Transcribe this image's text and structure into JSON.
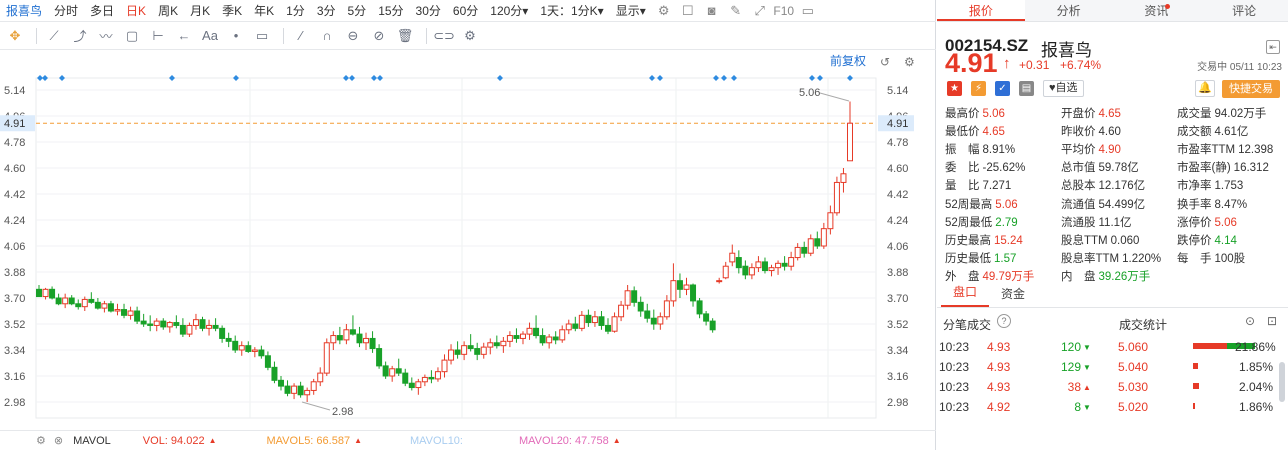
{
  "toolbar": {
    "timeframes": [
      {
        "label": "报喜鸟",
        "state": "stock"
      },
      {
        "label": "分时",
        "state": ""
      },
      {
        "label": "多日",
        "state": ""
      },
      {
        "label": "日K",
        "state": "active"
      },
      {
        "label": "周K",
        "state": ""
      },
      {
        "label": "月K",
        "state": ""
      },
      {
        "label": "季K",
        "state": ""
      },
      {
        "label": "年K",
        "state": ""
      },
      {
        "label": "1分",
        "state": ""
      },
      {
        "label": "3分",
        "state": ""
      },
      {
        "label": "5分",
        "state": ""
      },
      {
        "label": "15分",
        "state": ""
      },
      {
        "label": "30分",
        "state": ""
      },
      {
        "label": "60分",
        "state": ""
      },
      {
        "label": "120分",
        "state": "dropdown"
      },
      {
        "label": "1天：1分K",
        "state": "dropdown"
      },
      {
        "label": "显示",
        "state": "dropdown"
      }
    ],
    "icons": [
      "settings-icon",
      "checkbox-icon",
      "camera-icon",
      "pencil-icon",
      "expand-icon",
      "f10-icon",
      "window-icon"
    ],
    "f10_label": "F10"
  },
  "drawing_tools": [
    "cursor-icon",
    "line-icon",
    "ray-icon",
    "wave-icon",
    "rect-icon",
    "measure-icon",
    "arrow-icon",
    "text-icon",
    "comment-icon",
    "ruler-icon",
    "magnet-icon",
    "lock-icon",
    "hide-icon",
    "delete-icon",
    "toggle-icon",
    "settings-icon"
  ],
  "text_tool_label": "Aa",
  "chart": {
    "adjust_label": "前复权",
    "price_levels": [
      "5.14",
      "4.96",
      "4.78",
      "4.60",
      "4.42",
      "4.24",
      "4.06",
      "3.88",
      "3.70",
      "3.52",
      "3.34",
      "3.16",
      "2.98"
    ],
    "current_marker": "4.91",
    "high_annotation": "5.06",
    "low_annotation": "2.98"
  },
  "chart_data": {
    "type": "candlestick",
    "ylim": [
      2.9,
      5.14
    ],
    "candles": [
      [
        3.76,
        3.79,
        3.71,
        3.71
      ],
      [
        3.71,
        3.77,
        3.69,
        3.76
      ],
      [
        3.76,
        3.78,
        3.69,
        3.7
      ],
      [
        3.7,
        3.73,
        3.65,
        3.66
      ],
      [
        3.66,
        3.73,
        3.63,
        3.7
      ],
      [
        3.7,
        3.72,
        3.65,
        3.66
      ],
      [
        3.66,
        3.69,
        3.62,
        3.64
      ],
      [
        3.64,
        3.71,
        3.61,
        3.69
      ],
      [
        3.69,
        3.74,
        3.66,
        3.67
      ],
      [
        3.67,
        3.7,
        3.62,
        3.63
      ],
      [
        3.63,
        3.68,
        3.6,
        3.66
      ],
      [
        3.66,
        3.68,
        3.6,
        3.61
      ],
      [
        3.61,
        3.66,
        3.58,
        3.62
      ],
      [
        3.62,
        3.66,
        3.56,
        3.58
      ],
      [
        3.58,
        3.64,
        3.55,
        3.61
      ],
      [
        3.61,
        3.64,
        3.52,
        3.54
      ],
      [
        3.54,
        3.59,
        3.5,
        3.52
      ],
      [
        3.52,
        3.58,
        3.47,
        3.51
      ],
      [
        3.51,
        3.56,
        3.47,
        3.54
      ],
      [
        3.54,
        3.56,
        3.48,
        3.5
      ],
      [
        3.5,
        3.54,
        3.46,
        3.53
      ],
      [
        3.53,
        3.58,
        3.49,
        3.51
      ],
      [
        3.51,
        3.56,
        3.43,
        3.45
      ],
      [
        3.45,
        3.53,
        3.43,
        3.51
      ],
      [
        3.51,
        3.59,
        3.48,
        3.55
      ],
      [
        3.55,
        3.57,
        3.47,
        3.49
      ],
      [
        3.49,
        3.55,
        3.44,
        3.51
      ],
      [
        3.51,
        3.56,
        3.47,
        3.49
      ],
      [
        3.49,
        3.51,
        3.39,
        3.42
      ],
      [
        3.42,
        3.46,
        3.36,
        3.4
      ],
      [
        3.4,
        3.44,
        3.32,
        3.34
      ],
      [
        3.34,
        3.4,
        3.3,
        3.37
      ],
      [
        3.37,
        3.4,
        3.32,
        3.33
      ],
      [
        3.33,
        3.36,
        3.29,
        3.34
      ],
      [
        3.34,
        3.37,
        3.28,
        3.3
      ],
      [
        3.3,
        3.33,
        3.2,
        3.22
      ],
      [
        3.22,
        3.26,
        3.11,
        3.13
      ],
      [
        3.13,
        3.16,
        3.06,
        3.09
      ],
      [
        3.09,
        3.13,
        3.02,
        3.04
      ],
      [
        3.04,
        3.11,
        3.0,
        3.09
      ],
      [
        3.09,
        3.12,
        3.01,
        3.03
      ],
      [
        3.03,
        3.08,
        2.98,
        3.06
      ],
      [
        3.06,
        3.14,
        3.03,
        3.12
      ],
      [
        3.12,
        3.22,
        3.09,
        3.18
      ],
      [
        3.18,
        3.42,
        3.16,
        3.39
      ],
      [
        3.39,
        3.47,
        3.34,
        3.44
      ],
      [
        3.44,
        3.5,
        3.38,
        3.41
      ],
      [
        3.41,
        3.52,
        3.38,
        3.48
      ],
      [
        3.48,
        3.58,
        3.44,
        3.45
      ],
      [
        3.45,
        3.5,
        3.36,
        3.39
      ],
      [
        3.39,
        3.46,
        3.34,
        3.42
      ],
      [
        3.42,
        3.47,
        3.32,
        3.35
      ],
      [
        3.35,
        3.38,
        3.21,
        3.23
      ],
      [
        3.23,
        3.26,
        3.14,
        3.16
      ],
      [
        3.16,
        3.23,
        3.12,
        3.21
      ],
      [
        3.21,
        3.28,
        3.16,
        3.18
      ],
      [
        3.18,
        3.21,
        3.09,
        3.11
      ],
      [
        3.11,
        3.15,
        3.06,
        3.08
      ],
      [
        3.08,
        3.14,
        3.03,
        3.12
      ],
      [
        3.12,
        3.17,
        3.09,
        3.15
      ],
      [
        3.15,
        3.2,
        3.11,
        3.14
      ],
      [
        3.14,
        3.22,
        3.12,
        3.19
      ],
      [
        3.19,
        3.31,
        3.15,
        3.27
      ],
      [
        3.27,
        3.38,
        3.24,
        3.34
      ],
      [
        3.34,
        3.4,
        3.28,
        3.31
      ],
      [
        3.31,
        3.4,
        3.27,
        3.37
      ],
      [
        3.37,
        3.45,
        3.33,
        3.35
      ],
      [
        3.35,
        3.39,
        3.27,
        3.31
      ],
      [
        3.31,
        3.39,
        3.28,
        3.36
      ],
      [
        3.36,
        3.42,
        3.31,
        3.39
      ],
      [
        3.39,
        3.44,
        3.35,
        3.37
      ],
      [
        3.37,
        3.43,
        3.32,
        3.4
      ],
      [
        3.4,
        3.47,
        3.36,
        3.44
      ],
      [
        3.44,
        3.49,
        3.39,
        3.42
      ],
      [
        3.42,
        3.47,
        3.38,
        3.45
      ],
      [
        3.45,
        3.53,
        3.41,
        3.49
      ],
      [
        3.49,
        3.58,
        3.42,
        3.44
      ],
      [
        3.44,
        3.49,
        3.37,
        3.39
      ],
      [
        3.39,
        3.45,
        3.35,
        3.43
      ],
      [
        3.43,
        3.47,
        3.38,
        3.41
      ],
      [
        3.41,
        3.51,
        3.39,
        3.48
      ],
      [
        3.48,
        3.55,
        3.45,
        3.52
      ],
      [
        3.52,
        3.57,
        3.47,
        3.49
      ],
      [
        3.49,
        3.61,
        3.47,
        3.58
      ],
      [
        3.58,
        3.62,
        3.5,
        3.53
      ],
      [
        3.53,
        3.61,
        3.5,
        3.57
      ],
      [
        3.57,
        3.61,
        3.48,
        3.51
      ],
      [
        3.51,
        3.56,
        3.45,
        3.47
      ],
      [
        3.47,
        3.6,
        3.46,
        3.57
      ],
      [
        3.57,
        3.68,
        3.54,
        3.65
      ],
      [
        3.65,
        3.79,
        3.62,
        3.75
      ],
      [
        3.75,
        3.78,
        3.64,
        3.67
      ],
      [
        3.67,
        3.71,
        3.57,
        3.61
      ],
      [
        3.61,
        3.66,
        3.53,
        3.56
      ],
      [
        3.56,
        3.62,
        3.48,
        3.52
      ],
      [
        3.52,
        3.6,
        3.48,
        3.57
      ],
      [
        3.57,
        3.72,
        3.55,
        3.68
      ],
      [
        3.68,
        3.94,
        3.64,
        3.82
      ],
      [
        3.82,
        3.87,
        3.7,
        3.76
      ],
      [
        3.76,
        3.84,
        3.72,
        3.79
      ],
      [
        3.79,
        3.8,
        3.64,
        3.68
      ],
      [
        3.68,
        3.7,
        3.56,
        3.59
      ],
      [
        3.59,
        3.61,
        3.51,
        3.54
      ],
      [
        3.54,
        3.56,
        3.46,
        3.48
      ],
      [
        3.82,
        3.84,
        3.8,
        3.82
      ],
      [
        3.84,
        3.95,
        3.83,
        3.92
      ],
      [
        3.95,
        4.07,
        3.92,
        4.01
      ],
      [
        3.98,
        4.03,
        3.87,
        3.91
      ],
      [
        3.92,
        3.96,
        3.83,
        3.86
      ],
      [
        3.86,
        3.94,
        3.83,
        3.91
      ],
      [
        3.91,
        3.99,
        3.88,
        3.95
      ],
      [
        3.95,
        3.98,
        3.87,
        3.89
      ],
      [
        3.89,
        3.93,
        3.85,
        3.91
      ],
      [
        3.91,
        3.96,
        3.86,
        3.94
      ],
      [
        3.94,
        3.99,
        3.89,
        3.92
      ],
      [
        3.92,
        4.02,
        3.89,
        3.98
      ],
      [
        3.98,
        4.08,
        3.96,
        4.05
      ],
      [
        4.05,
        4.09,
        3.98,
        4.01
      ],
      [
        4.01,
        4.14,
        3.99,
        4.11
      ],
      [
        4.11,
        4.16,
        4.04,
        4.06
      ],
      [
        4.06,
        4.22,
        4.04,
        4.18
      ],
      [
        4.18,
        4.34,
        4.14,
        4.29
      ],
      [
        4.29,
        4.54,
        4.27,
        4.5
      ],
      [
        4.5,
        4.6,
        4.43,
        4.56
      ],
      [
        4.65,
        5.06,
        4.65,
        4.91
      ]
    ]
  },
  "volume_bar": {
    "indicator": "MAVOL",
    "vol": "VOL: 94.022",
    "mavol5": "MAVOL5: 66.587",
    "mavol10": "MAVOL10:",
    "mavol20": "MAVOL20: 47.758",
    "colors": {
      "vol": "#e63a27",
      "mavol5": "#f39b33",
      "mavol10": "#a9cdf0",
      "mavol20": "#e26ab8"
    }
  },
  "panel": {
    "tabs": [
      "报价",
      "分析",
      "资讯",
      "评论"
    ],
    "code": "002154.SZ",
    "name": "报喜鸟",
    "price": "4.91",
    "arrow": "↑",
    "change": "+0.31",
    "change_pct": "+6.74%",
    "trade_status": "交易中 05/11 10:23",
    "watch_label": "♥自选",
    "quick_trade_label": "快捷交易",
    "bell_label": "🔔",
    "badges": [
      {
        "text": "★",
        "color": "#e63a27"
      },
      {
        "text": "⚡",
        "color": "#f39b33"
      },
      {
        "text": "✓",
        "color": "#2f6fd6"
      },
      {
        "text": "▤",
        "color": "#888888"
      }
    ]
  },
  "stats": {
    "col1": [
      {
        "k": "最高价",
        "v": "5.06",
        "c": "up"
      },
      {
        "k": "最低价",
        "v": "4.65",
        "c": "up"
      },
      {
        "k": "振　幅",
        "v": "8.91%",
        "c": ""
      },
      {
        "k": "委　比",
        "v": "-25.62%",
        "c": ""
      },
      {
        "k": "量　比",
        "v": "7.271",
        "c": ""
      },
      {
        "k": "52周最高",
        "v": "5.06",
        "c": "up"
      },
      {
        "k": "52周最低",
        "v": "2.79",
        "c": "dn"
      },
      {
        "k": "历史最高",
        "v": "15.24",
        "c": "up"
      },
      {
        "k": "历史最低",
        "v": "1.57",
        "c": "dn"
      }
    ],
    "col2": [
      {
        "k": "开盘价",
        "v": "4.65",
        "c": "up"
      },
      {
        "k": "昨收价",
        "v": "4.60",
        "c": ""
      },
      {
        "k": "平均价",
        "v": "4.90",
        "c": "up"
      },
      {
        "k": "总市值",
        "v": "59.78亿",
        "c": ""
      },
      {
        "k": "总股本",
        "v": "12.176亿",
        "c": ""
      },
      {
        "k": "流通值",
        "v": "54.499亿",
        "c": ""
      },
      {
        "k": "流通股",
        "v": "11.1亿",
        "c": ""
      },
      {
        "k": "股息TTM",
        "v": "0.060",
        "c": ""
      },
      {
        "k": "股息率TTM",
        "v": "1.220%",
        "c": ""
      }
    ],
    "col3": [
      {
        "k": "成交量",
        "v": "94.02万手",
        "c": ""
      },
      {
        "k": "成交额",
        "v": "4.61亿",
        "c": ""
      },
      {
        "k": "市盈率TTM",
        "v": "12.398",
        "c": ""
      },
      {
        "k": "市盈率(静)",
        "v": "16.312",
        "c": ""
      },
      {
        "k": "市净率",
        "v": "1.753",
        "c": ""
      },
      {
        "k": "换手率",
        "v": "8.47%",
        "c": ""
      },
      {
        "k": "涨停价",
        "v": "5.06",
        "c": "up"
      },
      {
        "k": "跌停价",
        "v": "4.14",
        "c": "dn"
      },
      {
        "k": "每　手",
        "v": "100股",
        "c": ""
      }
    ],
    "outer": {
      "k": "外　盘",
      "v": "49.79万手"
    },
    "inner": {
      "k": "内　盘",
      "v": "39.26万手"
    }
  },
  "sub_tabs": [
    "盘口",
    "资金"
  ],
  "trades_section": {
    "left": "分笔成交",
    "right": "成交统计"
  },
  "trades": [
    {
      "time": "10:23",
      "price": "4.93",
      "vol": "120",
      "dir": "dn",
      "sprice": "5.060",
      "pct": "21.86%",
      "bar": 78
    },
    {
      "time": "10:23",
      "price": "4.93",
      "vol": "129",
      "dir": "dn",
      "sprice": "5.040",
      "pct": "1.85%",
      "bar": 6
    },
    {
      "time": "10:23",
      "price": "4.93",
      "vol": "38",
      "dir": "up",
      "sprice": "5.030",
      "pct": "2.04%",
      "bar": 7
    },
    {
      "time": "10:23",
      "price": "4.92",
      "vol": "8",
      "dir": "dn",
      "sprice": "5.020",
      "pct": "1.86%",
      "bar": 2
    }
  ]
}
